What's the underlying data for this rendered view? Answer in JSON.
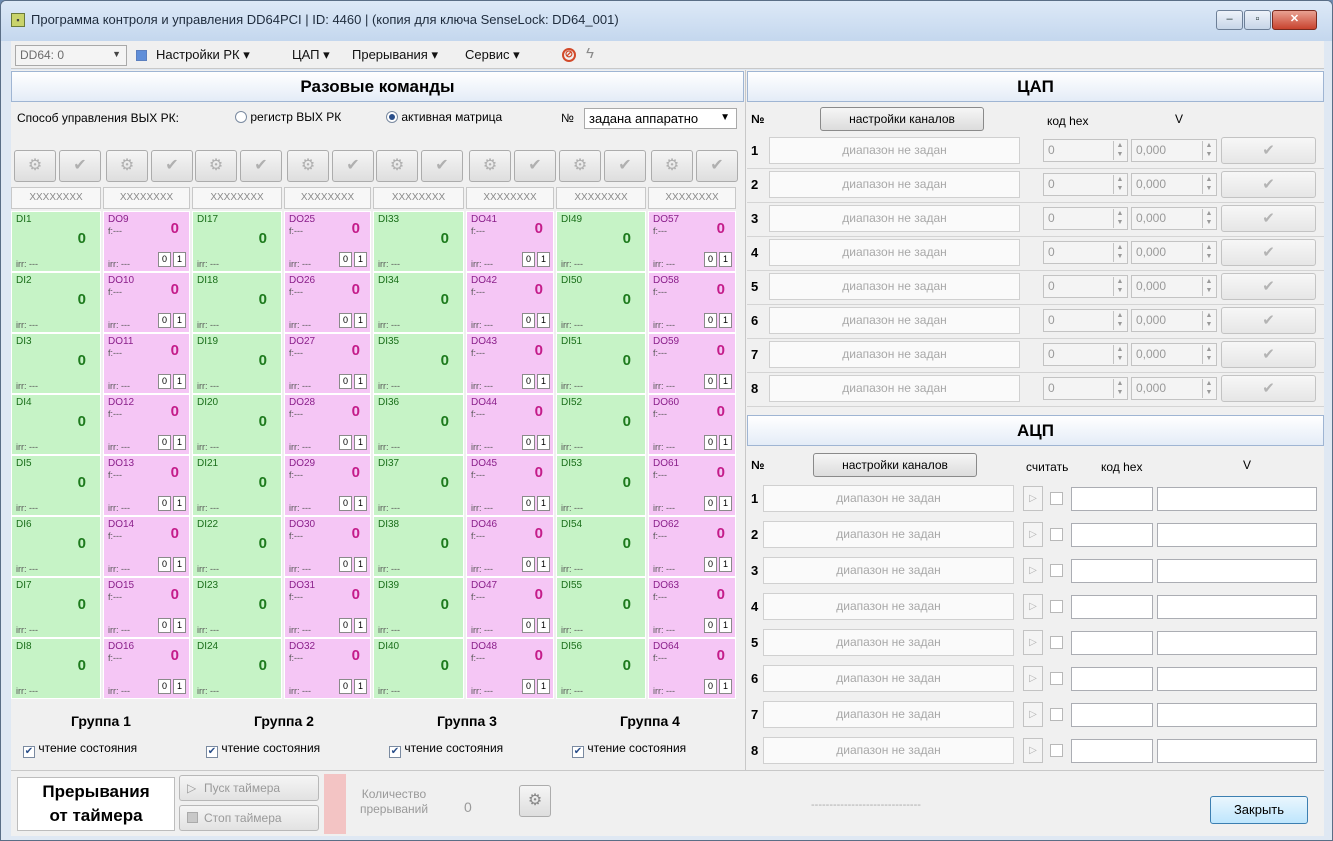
{
  "window": {
    "title": "Программа контроля и управления DD64PCI | ID: 4460 | (копия для ключа SenseLock: DD64_001)",
    "min": "‒",
    "max": "▫",
    "close": "✕"
  },
  "toolbar": {
    "device": "DD64: 0",
    "menus": [
      "Настройки РК ▾",
      "ЦАП ▾",
      "Прерывания ▾",
      "Сервис ▾"
    ]
  },
  "left": {
    "title": "Разовые команды",
    "mode_label": "Способ управления ВЫХ РК:",
    "mode_opt1": "регистр ВЫХ РК",
    "mode_opt2": "активная матрица",
    "mode_selected": "активная матрица",
    "num_label": "№",
    "num_value": "задана аппаратно",
    "mask_values": [
      "XXXXXXXX",
      "XXXXXXXX",
      "XXXXXXXX",
      "XXXXXXXX",
      "XXXXXXXX",
      "XXXXXXXX",
      "XXXXXXXX",
      "XXXXXXXX"
    ],
    "freq_text": "f:---",
    "irr_text": "irr: ---",
    "bit0": "0",
    "bit1": "1",
    "columns": [
      {
        "kind": "DI",
        "start": 1
      },
      {
        "kind": "DO",
        "start": 9
      },
      {
        "kind": "DI",
        "start": 17
      },
      {
        "kind": "DO",
        "start": 25
      },
      {
        "kind": "DI",
        "start": 33
      },
      {
        "kind": "DO",
        "start": 41
      },
      {
        "kind": "DI",
        "start": 49
      },
      {
        "kind": "DO",
        "start": 57
      }
    ],
    "cell_value": "0",
    "groups": [
      {
        "title": "Группа 1",
        "check": "чтение состояния",
        "checked": true
      },
      {
        "title": "Группа 2",
        "check": "чтение состояния",
        "checked": true
      },
      {
        "title": "Группа 3",
        "check": "чтение состояния",
        "checked": true
      },
      {
        "title": "Группа 4",
        "check": "чтение состояния",
        "checked": true
      }
    ]
  },
  "dac": {
    "title": "ЦАП",
    "col_num": "№",
    "col_btn": "настройки каналов",
    "col_hex": "код hex",
    "col_v": "V",
    "rows": [
      {
        "n": "1",
        "range": "диапазон не задан",
        "hex": "0",
        "v": "0,000"
      },
      {
        "n": "2",
        "range": "диапазон не задан",
        "hex": "0",
        "v": "0,000"
      },
      {
        "n": "3",
        "range": "диапазон не задан",
        "hex": "0",
        "v": "0,000"
      },
      {
        "n": "4",
        "range": "диапазон не задан",
        "hex": "0",
        "v": "0,000"
      },
      {
        "n": "5",
        "range": "диапазон не задан",
        "hex": "0",
        "v": "0,000"
      },
      {
        "n": "6",
        "range": "диапазон не задан",
        "hex": "0",
        "v": "0,000"
      },
      {
        "n": "7",
        "range": "диапазон не задан",
        "hex": "0",
        "v": "0,000"
      },
      {
        "n": "8",
        "range": "диапазон не задан",
        "hex": "0",
        "v": "0,000"
      }
    ]
  },
  "adc": {
    "title": "АЦП",
    "col_num": "№",
    "col_btn": "настройки каналов",
    "col_read": "считать",
    "col_hex": "код hex",
    "col_v": "V",
    "rows": [
      {
        "n": "1",
        "range": "диапазон не задан"
      },
      {
        "n": "2",
        "range": "диапазон не задан"
      },
      {
        "n": "3",
        "range": "диапазон не задан"
      },
      {
        "n": "4",
        "range": "диапазон не задан"
      },
      {
        "n": "5",
        "range": "диапазон не задан"
      },
      {
        "n": "6",
        "range": "диапазон не задан"
      },
      {
        "n": "7",
        "range": "диапазон не задан"
      },
      {
        "n": "8",
        "range": "диапазон не задан"
      }
    ]
  },
  "timer": {
    "title1": "Прерывания",
    "title2": "от таймера",
    "start": "Пуск таймера",
    "stop": "Стоп таймера",
    "count_label1": "Количество",
    "count_label2": "прерываний",
    "count": "0",
    "status": "------------------------------"
  },
  "footer": {
    "close": "Закрыть"
  }
}
